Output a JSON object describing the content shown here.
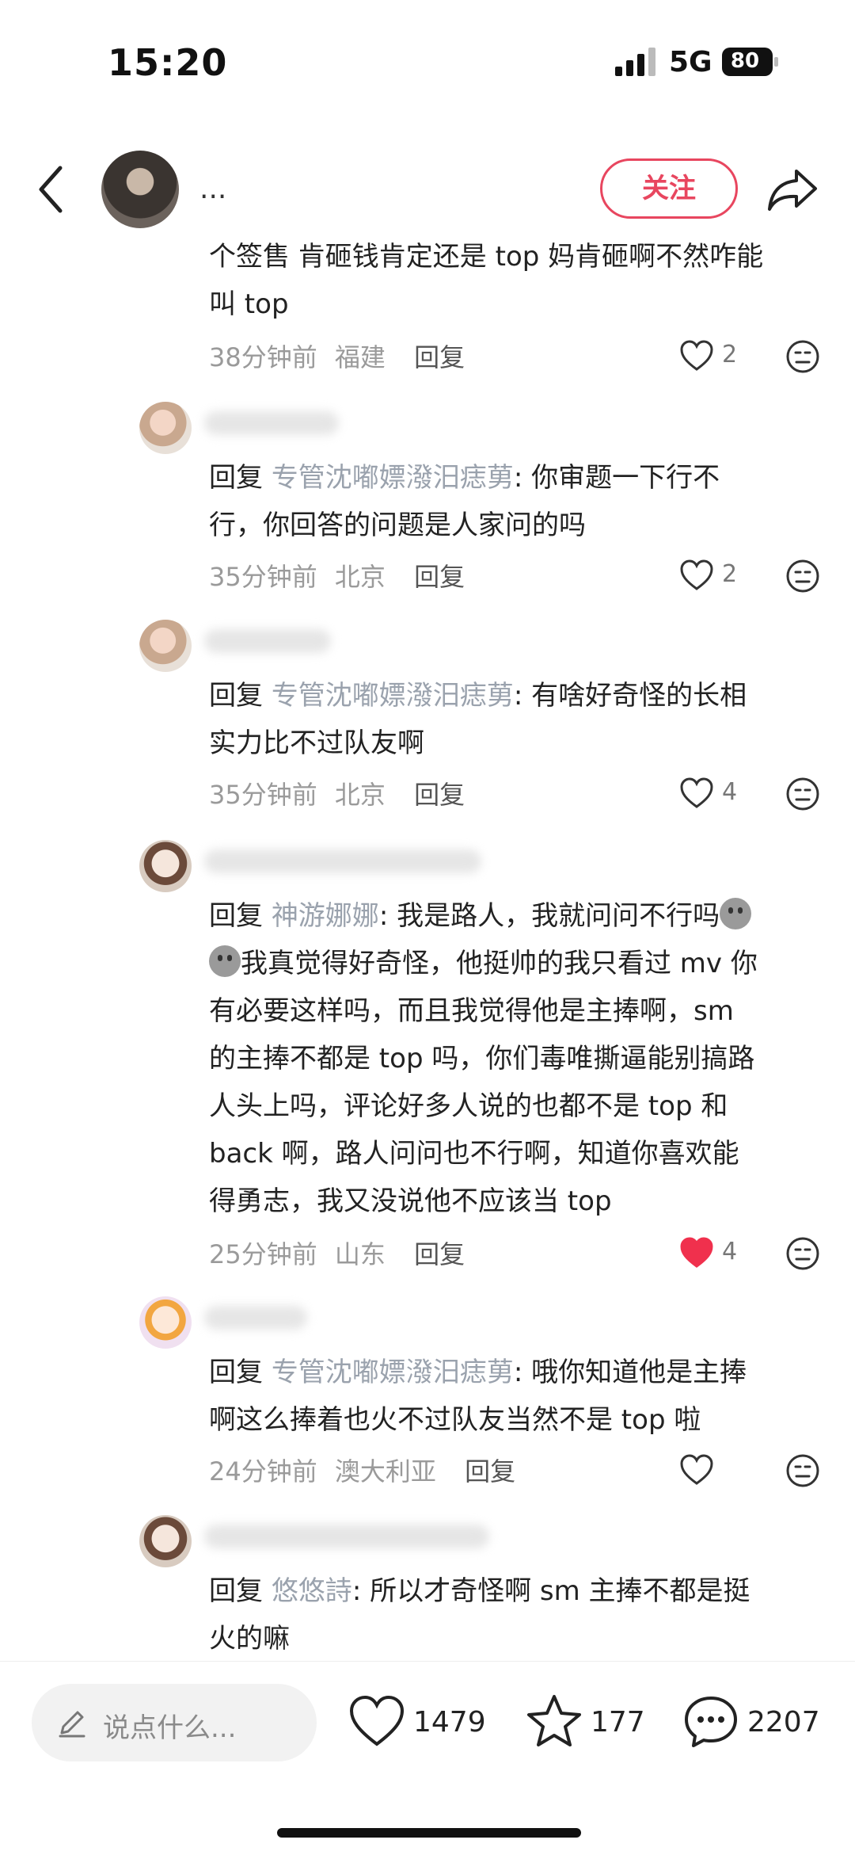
{
  "status": {
    "time": "15:20",
    "network": "5G",
    "battery": "80"
  },
  "header": {
    "author_name": "...",
    "follow_label": "关注"
  },
  "comments": [
    {
      "text_lines": [
        "个签售 肯砸钱肯定还是 top 妈肯砸啊不然咋能",
        "叫 top"
      ],
      "time": "38分钟前",
      "location": "福建",
      "reply_label": "回复",
      "likes": "2",
      "liked": false
    },
    {
      "reply_prefix": "回复 ",
      "mention": "专管沈嘟嫖潑汨痣莮",
      "colon": ": ",
      "text_lines": [
        "你审题一下行不",
        "行，你回答的问题是人家问的吗"
      ],
      "time": "35分钟前",
      "location": "北京",
      "reply_label": "回复",
      "likes": "2",
      "liked": false
    },
    {
      "reply_prefix": "回复 ",
      "mention": "专管沈嘟嫖潑汨痣莮",
      "colon": ": ",
      "text_lines": [
        "有啥好奇怪的长相",
        "实力比不过队友啊"
      ],
      "time": "35分钟前",
      "location": "北京",
      "reply_label": "回复",
      "likes": "4",
      "liked": false
    },
    {
      "reply_prefix": "回复 ",
      "mention": "神游娜娜",
      "colon": ": ",
      "text_lines": [
        "我是路人，我就问问不行吗",
        "我真觉得好奇怪，他挺帅的我只看过 mv 你",
        "有必要这样吗，而且我觉得他是主捧啊，sm",
        "的主捧不都是 top 吗，你们毒唯撕逼能别搞路",
        "人头上吗，评论好多人说的也都不是 top 和",
        "back 啊，路人问问也不行啊，知道你喜欢能",
        "得勇志，我又没说他不应该当 top"
      ],
      "time": "25分钟前",
      "location": "山东",
      "reply_label": "回复",
      "likes": "4",
      "liked": true
    },
    {
      "reply_prefix": "回复 ",
      "mention": "专管沈嘟嫖潑汨痣莮",
      "colon": ": ",
      "text_lines": [
        "哦你知道他是主捧",
        "啊这么捧着也火不过队友当然不是 top 啦"
      ],
      "time": "24分钟前",
      "location": "澳大利亚",
      "reply_label": "回复",
      "likes": "",
      "liked": false
    },
    {
      "reply_prefix": "回复 ",
      "mention": "悠悠詩",
      "colon": ": ",
      "text_lines": [
        "所以才奇怪啊 sm 主捧不都是挺",
        "火的嘛"
      ]
    }
  ],
  "bottom": {
    "input_placeholder": "说点什么...",
    "likes": "1479",
    "favorites": "177",
    "comments": "2207"
  },
  "colors": {
    "accent": "#e8465f",
    "mention": "#9aa2ad",
    "meta": "#9a9a9a"
  }
}
